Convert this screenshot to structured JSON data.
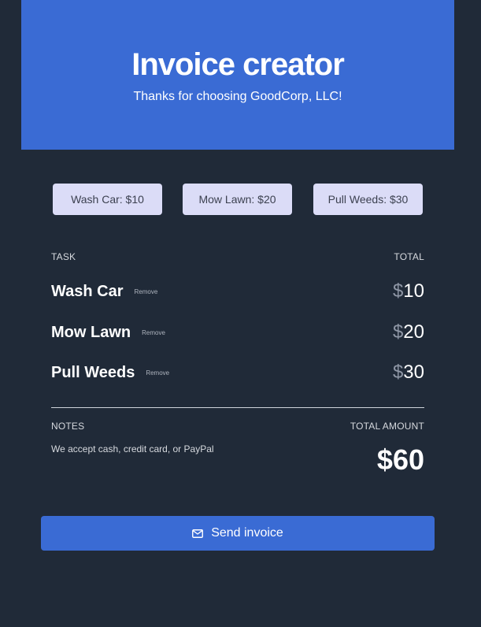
{
  "header": {
    "title": "Invoice creator",
    "subtitle": "Thanks for choosing GoodCorp, LLC!"
  },
  "services": [
    {
      "label": "Wash Car: $10"
    },
    {
      "label": "Mow Lawn: $20"
    },
    {
      "label": "Pull Weeds: $30"
    }
  ],
  "table": {
    "task_header": "TASK",
    "total_header": "TOTAL",
    "rows": [
      {
        "name": "Wash Car",
        "remove_label": "Remove",
        "currency": "$",
        "amount": "10"
      },
      {
        "name": "Mow Lawn",
        "remove_label": "Remove",
        "currency": "$",
        "amount": "20"
      },
      {
        "name": "Pull Weeds",
        "remove_label": "Remove",
        "currency": "$",
        "amount": "30"
      }
    ]
  },
  "summary": {
    "notes_label": "NOTES",
    "total_amount_label": "TOTAL AMOUNT",
    "notes_text": "We accept cash, credit card, or PayPal",
    "total_amount": "$60"
  },
  "send_button": {
    "label": "Send invoice",
    "icon": "envelope-icon"
  },
  "colors": {
    "accent": "#3a6bd4",
    "background": "#202a38",
    "service_button_bg": "#dbdcf7"
  }
}
